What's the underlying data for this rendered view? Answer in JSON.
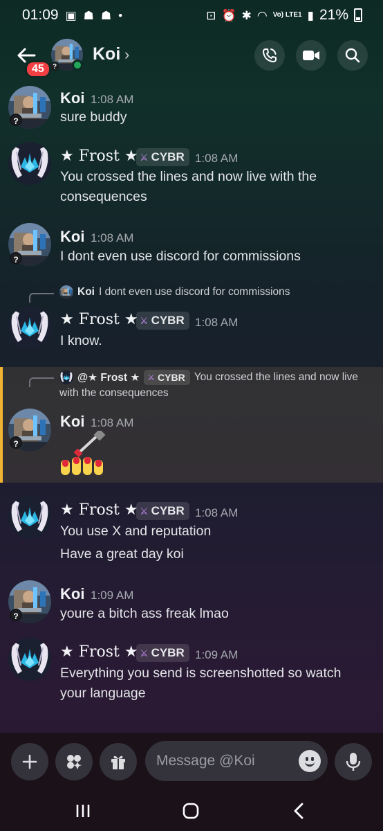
{
  "status_bar": {
    "time": "01:09",
    "battery": "21%",
    "network": "Vo) LTE1"
  },
  "header": {
    "title": "Koi",
    "unread_count": "45",
    "chevron": "›"
  },
  "colors": {
    "accent": "#f0b232",
    "online": "#23a55a",
    "badge": "#f23f43"
  },
  "messages": [
    {
      "author": "Koi",
      "time": "1:08 AM",
      "lines": [
        "sure buddy"
      ]
    },
    {
      "author": "★ Frost ★",
      "tag": "CYBR",
      "time": "1:08 AM",
      "lines": [
        "You crossed the lines and now live with the consequences"
      ]
    },
    {
      "author": "Koi",
      "time": "1:08 AM",
      "lines": [
        "I dont even use discord for commissions"
      ]
    },
    {
      "reply_author": "Koi",
      "reply_text": "I dont even use discord for commissions",
      "author": "★ Frost ★",
      "tag": "CYBR",
      "time": "1:08 AM",
      "lines": [
        "I know."
      ]
    },
    {
      "reply_author": "@★ Frost ★",
      "reply_tag": "CYBR",
      "reply_text": "You crossed the lines and now live",
      "reply_text2": "with the consequences",
      "author": "Koi",
      "time": "1:08 AM",
      "emoji": "nail-polish-emoji"
    },
    {
      "author": "★ Frost ★",
      "tag": "CYBR",
      "time": "1:08 AM",
      "lines": [
        "You use X and reputation",
        "Have a great day koi"
      ]
    },
    {
      "author": "Koi",
      "time": "1:09 AM",
      "lines": [
        "youre a bitch ass freak lmao"
      ]
    },
    {
      "author": "★ Frost ★",
      "tag": "CYBR",
      "time": "1:09 AM",
      "lines": [
        "Everything you send is screenshotted so watch your language"
      ]
    }
  ],
  "composer": {
    "placeholder": "Message @Koi"
  }
}
